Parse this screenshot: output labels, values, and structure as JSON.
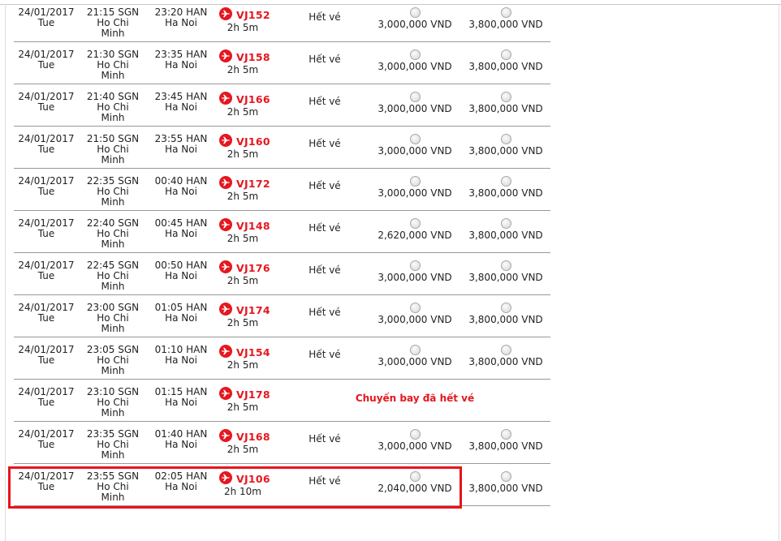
{
  "status_label": "Hết vé",
  "route": {
    "origin_code": "SGN",
    "origin_city": "Ho Chi Minh",
    "dest_code": "HAN",
    "dest_city": "Ha Noi"
  },
  "accent_color": "#e5171f",
  "flights": [
    {
      "date": "24/01/2017",
      "weekday": "Tue",
      "dep_time": "21:15",
      "arr_time": "23:20",
      "flight_no": "VJ152",
      "duration": "2h 5m",
      "status": "Hết vé",
      "fare_1": "3,000,000 VND",
      "fare_2": "3,800,000 VND"
    },
    {
      "date": "24/01/2017",
      "weekday": "Tue",
      "dep_time": "21:30",
      "arr_time": "23:35",
      "flight_no": "VJ158",
      "duration": "2h 5m",
      "status": "Hết vé",
      "fare_1": "3,000,000 VND",
      "fare_2": "3,800,000 VND"
    },
    {
      "date": "24/01/2017",
      "weekday": "Tue",
      "dep_time": "21:40",
      "arr_time": "23:45",
      "flight_no": "VJ166",
      "duration": "2h 5m",
      "status": "Hết vé",
      "fare_1": "3,000,000 VND",
      "fare_2": "3,800,000 VND"
    },
    {
      "date": "24/01/2017",
      "weekday": "Tue",
      "dep_time": "21:50",
      "arr_time": "23:55",
      "flight_no": "VJ160",
      "duration": "2h 5m",
      "status": "Hết vé",
      "fare_1": "3,000,000 VND",
      "fare_2": "3,800,000 VND"
    },
    {
      "date": "24/01/2017",
      "weekday": "Tue",
      "dep_time": "22:35",
      "arr_time": "00:40",
      "flight_no": "VJ172",
      "duration": "2h 5m",
      "status": "Hết vé",
      "fare_1": "3,000,000 VND",
      "fare_2": "3,800,000 VND"
    },
    {
      "date": "24/01/2017",
      "weekday": "Tue",
      "dep_time": "22:40",
      "arr_time": "00:45",
      "flight_no": "VJ148",
      "duration": "2h 5m",
      "status": "Hết vé",
      "fare_1": "2,620,000 VND",
      "fare_2": "3,800,000 VND"
    },
    {
      "date": "24/01/2017",
      "weekday": "Tue",
      "dep_time": "22:45",
      "arr_time": "00:50",
      "flight_no": "VJ176",
      "duration": "2h 5m",
      "status": "Hết vé",
      "fare_1": "3,000,000 VND",
      "fare_2": "3,800,000 VND"
    },
    {
      "date": "24/01/2017",
      "weekday": "Tue",
      "dep_time": "23:00",
      "arr_time": "01:05",
      "flight_no": "VJ174",
      "duration": "2h 5m",
      "status": "Hết vé",
      "fare_1": "3,000,000 VND",
      "fare_2": "3,800,000 VND"
    },
    {
      "date": "24/01/2017",
      "weekday": "Tue",
      "dep_time": "23:05",
      "arr_time": "01:10",
      "flight_no": "VJ154",
      "duration": "2h 5m",
      "status": "Hết vé",
      "fare_1": "3,000,000 VND",
      "fare_2": "3,800,000 VND"
    },
    {
      "date": "24/01/2017",
      "weekday": "Tue",
      "dep_time": "23:10",
      "arr_time": "01:15",
      "flight_no": "VJ178",
      "duration": "2h 5m",
      "soldout_message": "Chuyến bay đã hết vé"
    },
    {
      "date": "24/01/2017",
      "weekday": "Tue",
      "dep_time": "23:35",
      "arr_time": "01:40",
      "flight_no": "VJ168",
      "duration": "2h 5m",
      "status": "Hết vé",
      "fare_1": "3,000,000 VND",
      "fare_2": "3,800,000 VND"
    },
    {
      "date": "24/01/2017",
      "weekday": "Tue",
      "dep_time": "23:55",
      "arr_time": "02:05",
      "flight_no": "VJ106",
      "duration": "2h 10m",
      "status": "Hết vé",
      "fare_1": "2,040,000 VND",
      "fare_2": "3,800,000 VND",
      "highlighted": true
    }
  ]
}
